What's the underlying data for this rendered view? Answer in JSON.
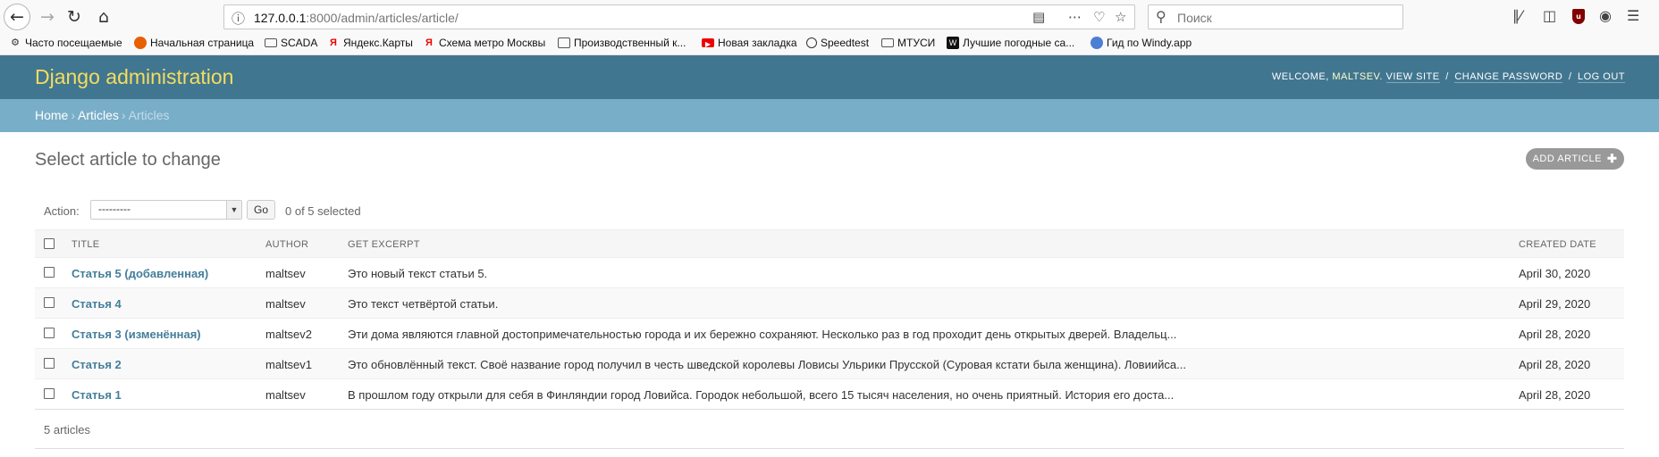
{
  "browser": {
    "url_host": "127.0.0.1",
    "url_rest": ":8000/admin/articles/article/",
    "search_placeholder": "Поиск",
    "bookmarks": [
      {
        "label": "Часто посещаемые",
        "icon": "gear-icon"
      },
      {
        "label": "Начальная страница",
        "icon": "firefox-icon"
      },
      {
        "label": "SCADA",
        "icon": "folder-icon"
      },
      {
        "label": "Яндекс.Карты",
        "icon": "yandex-icon"
      },
      {
        "label": "Схема метро Москвы",
        "icon": "yandex-icon"
      },
      {
        "label": "Производственный к...",
        "icon": "page-icon"
      },
      {
        "label": "Новая закладка",
        "icon": "youtube-icon"
      },
      {
        "label": "Speedtest",
        "icon": "speedometer-icon"
      },
      {
        "label": "МТУСИ",
        "icon": "folder-icon"
      },
      {
        "label": "Лучшие погодные са...",
        "icon": "weather-icon"
      },
      {
        "label": "Гид по Windy.app",
        "icon": "globe-icon"
      }
    ]
  },
  "header": {
    "branding": "Django administration",
    "welcome": "Welcome,",
    "username": "maltsev",
    "view_site": "View site",
    "change_password": "Change password",
    "log_out": "Log out"
  },
  "breadcrumbs": {
    "home": "Home",
    "app": "Articles",
    "current": "Articles"
  },
  "content": {
    "title": "Select article to change",
    "add_button": "Add article",
    "action_label": "Action:",
    "action_value": "---------",
    "go_label": "Go",
    "selected_count": "0 of 5 selected",
    "columns": [
      "Title",
      "Author",
      "Get excerpt",
      "Created date"
    ],
    "rows": [
      {
        "title": "Статья 5 (добавленная)",
        "author": "maltsev",
        "excerpt": "Это новый текст статьи 5.",
        "date": "April 30, 2020"
      },
      {
        "title": "Статья 4",
        "author": "maltsev",
        "excerpt": "Это текст четвёртой статьи.",
        "date": "April 29, 2020"
      },
      {
        "title": "Статья 3 (изменённая)",
        "author": "maltsev2",
        "excerpt": "Эти дома являются главной достопримечательностью города и их бережно сохраняют. Несколько раз в год проходит день открытых дверей. Владельц...",
        "date": "April 28, 2020"
      },
      {
        "title": "Статья 2",
        "author": "maltsev1",
        "excerpt": "Это обновлённый текст. Своё название город получил в честь шведской королевы Ловисы Ульрики Прусской (Суровая кстати была женщина). Ловиийса...",
        "date": "April 28, 2020"
      },
      {
        "title": "Статья 1",
        "author": "maltsev",
        "excerpt": "В прошлом году открыли для себя в Финляндии город Ловийса. Городок небольшой, всего 15 тысяч населения, но очень приятный. История его доста...",
        "date": "April 28, 2020"
      }
    ],
    "paginator": "5 articles"
  },
  "colors": {
    "header_bg": "#417690",
    "breadcrumbs_bg": "#79aec8",
    "branding": "#f5dd5d",
    "link": "#447e9b"
  }
}
